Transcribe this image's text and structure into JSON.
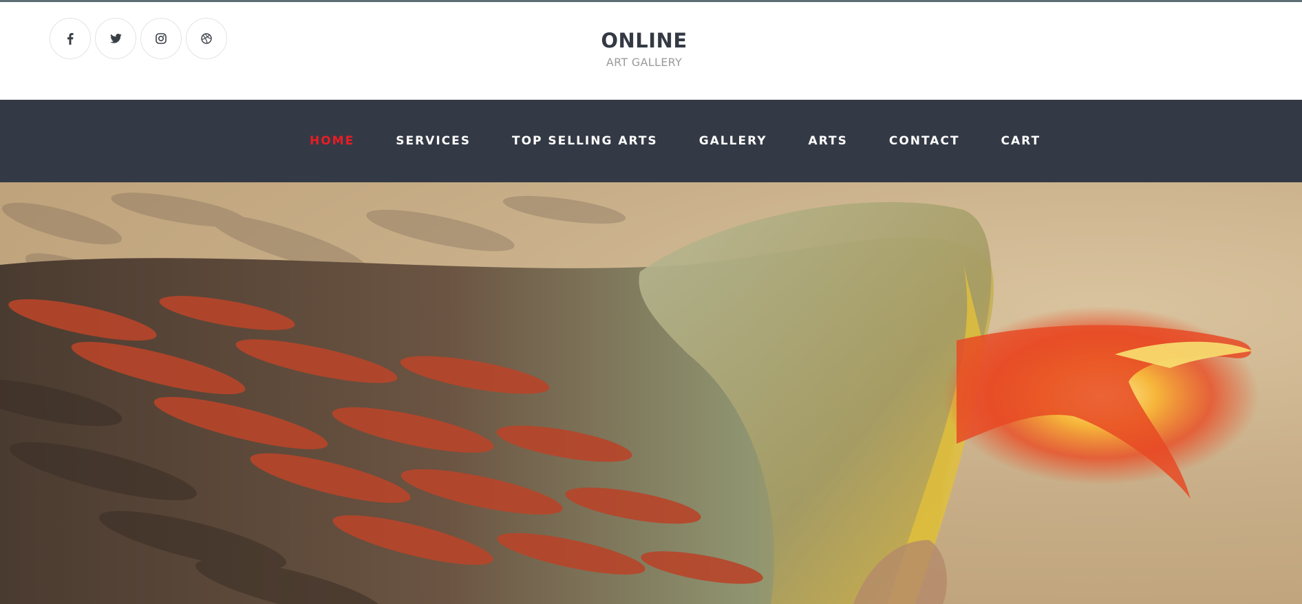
{
  "social": [
    {
      "icon": "facebook-icon",
      "label": "Facebook"
    },
    {
      "icon": "twitter-icon",
      "label": "Twitter"
    },
    {
      "icon": "instagram-icon",
      "label": "Instagram"
    },
    {
      "icon": "dribbble-icon",
      "label": "Dribbble"
    }
  ],
  "brand": {
    "title": "ONLINE",
    "subtitle": "ART GALLERY"
  },
  "nav": {
    "items": [
      {
        "label": "HOME",
        "active": true
      },
      {
        "label": "SERVICES",
        "active": false
      },
      {
        "label": "TOP SELLING ARTS",
        "active": false
      },
      {
        "label": "GALLERY",
        "active": false
      },
      {
        "label": "ARTS",
        "active": false
      },
      {
        "label": "CONTACT",
        "active": false
      },
      {
        "label": "CART",
        "active": false
      }
    ]
  },
  "hero": {
    "image": "phoenix-artwork"
  },
  "colors": {
    "nav_background": "#343a45",
    "nav_active": "#ea1c24",
    "nav_text": "#ffffff",
    "brand_title": "#343a44",
    "brand_subtitle": "#9a9a9a"
  }
}
